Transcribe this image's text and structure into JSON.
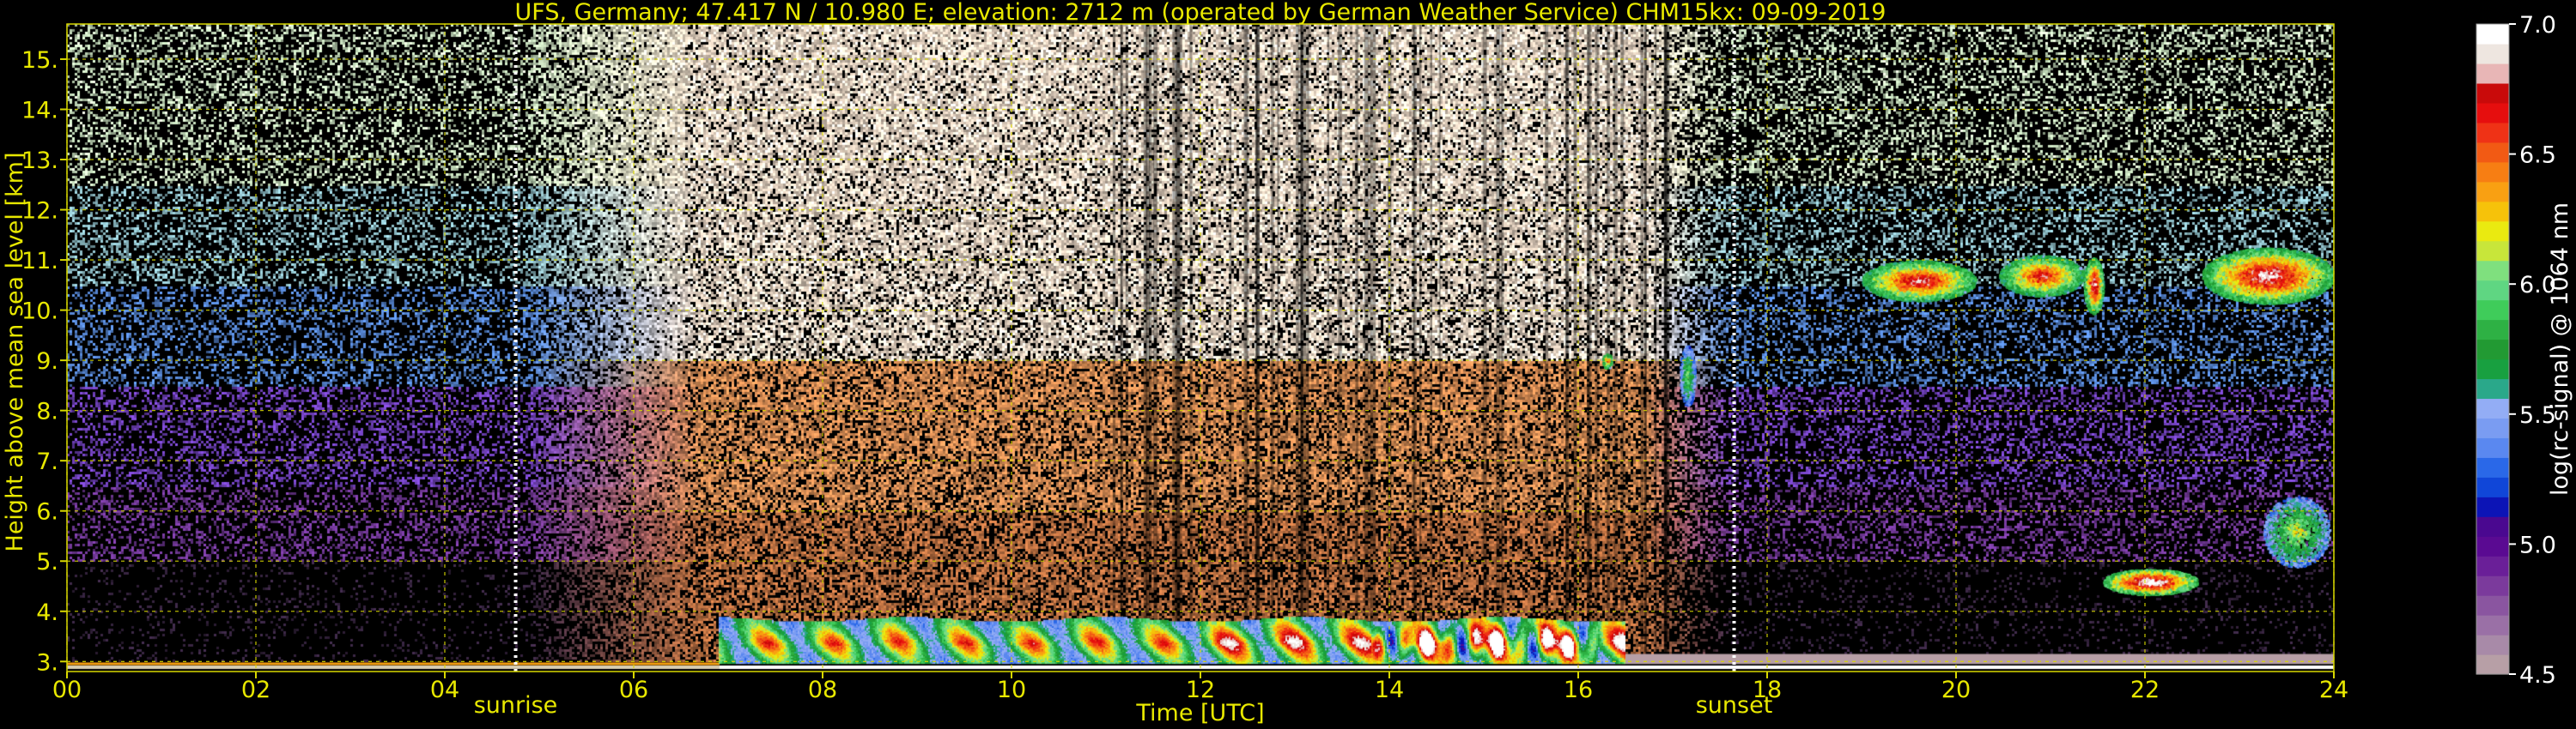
{
  "chart_data": {
    "type": "heatmap",
    "title": "UFS, Germany; 47.417 N / 10.980 E; elevation: 2712 m  (operated by German Weather Service)    CHM15kx: 09-09-2019",
    "xlabel": "Time [UTC]",
    "ylabel": "Height above mean sea level [km]",
    "xlim": [
      0,
      24
    ],
    "ylim": [
      2.8,
      15.7
    ],
    "x_ticks": [
      "00",
      "02",
      "04",
      "06",
      "08",
      "10",
      "12",
      "14",
      "16",
      "18",
      "20",
      "22",
      "24"
    ],
    "y_ticks": [
      "3.",
      "4.",
      "5.",
      "6.",
      "7.",
      "8.",
      "9.",
      "10.",
      "11.",
      "12.",
      "13.",
      "14.",
      "15."
    ],
    "grid": true,
    "markers": [
      {
        "label": "sunrise",
        "time": 4.75
      },
      {
        "label": "sunset",
        "time": 17.65
      }
    ],
    "colorbar": {
      "label": "log(rc-signal) @ 1064 nm",
      "range": [
        4.5,
        7.0
      ],
      "ticks": [
        "4.5",
        "5.0",
        "5.5",
        "6.0",
        "6.5",
        "7.0"
      ],
      "colors": [
        "#b79fa6",
        "#a88aa8",
        "#9a70a6",
        "#8a55a0",
        "#7b3a9c",
        "#6a1f98",
        "#5a0a92",
        "#4a0890",
        "#0c14b6",
        "#1046d8",
        "#2a68e8",
        "#5a88f0",
        "#7a9cf2",
        "#93adf5",
        "#2aa88a",
        "#18a040",
        "#229a33",
        "#2eb144",
        "#3fcc5a",
        "#5fd682",
        "#7fe07e",
        "#c8e63a",
        "#eaea10",
        "#f6c20a",
        "#f9a012",
        "#f77e13",
        "#f25a14",
        "#ef3216",
        "#e60e0e",
        "#c90a0a",
        "#e8b6b6",
        "#eee6e0",
        "#ffffff"
      ]
    },
    "features": [
      {
        "name": "boundary layer",
        "time_range": [
          6.9,
          16.5
        ],
        "height_range": [
          3.0,
          4.1
        ]
      },
      {
        "name": "daytime background noise",
        "time_range": [
          5.0,
          17.6
        ],
        "height_range": [
          3.5,
          15.7
        ]
      },
      {
        "name": "cirrus cloud",
        "time_range": [
          18.9,
          21.4
        ],
        "height_range": [
          10.2,
          11.2
        ]
      },
      {
        "name": "cirrus cloud",
        "time_range": [
          22.5,
          24.0
        ],
        "height_range": [
          9.8,
          11.5
        ]
      },
      {
        "name": "cloud",
        "time_range": [
          21.5,
          22.6
        ],
        "height_range": [
          4.2,
          5.0
        ]
      },
      {
        "name": "cloud",
        "time_range": [
          23.2,
          24.0
        ],
        "height_range": [
          4.8,
          6.5
        ]
      },
      {
        "name": "cloud",
        "time_range": [
          17.0,
          17.3
        ],
        "height_range": [
          8.0,
          9.5
        ]
      }
    ]
  }
}
